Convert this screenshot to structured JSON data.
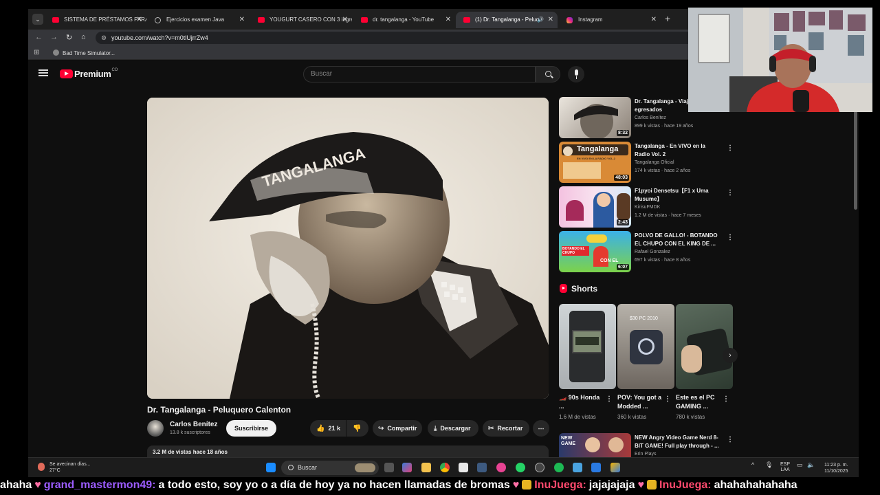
{
  "browser": {
    "tabs": [
      {
        "label": "SISTEMA DE PRÉSTAMOS PARA",
        "favicon": "youtube-icon"
      },
      {
        "label": "Ejercicios examen Java",
        "favicon": "globe-icon"
      },
      {
        "label": "YOUGURT CASERO CON 3 ingre",
        "favicon": "youtube-icon"
      },
      {
        "label": "dr. tangalanga - YouTube",
        "favicon": "youtube-icon"
      },
      {
        "label": "(1) Dr. Tangalanga - Peluqu",
        "favicon": "youtube-icon",
        "active": true
      },
      {
        "label": "Instagram",
        "favicon": "instagram-icon"
      }
    ],
    "url": "youtube.com/watch?v=m0tlUjrrZw4",
    "bookmark": "Bad Time Simulator..."
  },
  "youtube": {
    "logo_text": "Premium",
    "logo_sup": "CO",
    "search_placeholder": "Buscar"
  },
  "video": {
    "title": "Dr. Tangalanga - Peluquero Calenton",
    "channel": "Carlos Benítez",
    "subscribers": "13.8 k suscriptores",
    "subscribe_label": "Suscribirse",
    "likes": "21 k",
    "share_label": "Compartir",
    "download_label": "Descargar",
    "clip_label": "Recortar",
    "description_meta": "3.2 M de vistas  hace 18 años"
  },
  "recommendations": [
    {
      "title": "Dr. Tangalanga - Viaje de egresados",
      "channel": "Carlos Benítez",
      "meta": "899 k vistas · hace 19 años",
      "duration": "8:32"
    },
    {
      "title": "Tangalanga - En VIVO en la Radio Vol. 2",
      "channel": "Tangalanga Oficial",
      "meta": "174 k vistas · hace 2 años",
      "duration": "48:03",
      "thumb_text": "Tangalanga",
      "thumb_sub": "EN VIVO EN LA RADIO VOL.2"
    },
    {
      "title": "F1pyoi Densetsu【F1 x Uma Musume】",
      "channel": "KirisuFMDK",
      "meta": "1.2 M de vistas · hace 7 meses",
      "duration": "2:43"
    },
    {
      "title": "POLVO DE GALLO! - BOTANDO EL CHUPO CON EL KING DE ...",
      "channel": "Rafael Gonzalez",
      "meta": "697 k vistas · hace 8 años",
      "duration": "6:07",
      "thumb_text": "BOTANDO EL CHUPO",
      "thumb_sub": "CON EL"
    },
    {
      "title": "NEW Angry Video Game Nerd 8-BIT GAME! Full play through - ...",
      "channel": "Erin Plays",
      "meta": "",
      "thumb_text": "NEW GAME"
    }
  ],
  "shorts": {
    "heading": "Shorts",
    "items": [
      {
        "title": "🏎️ 90s Honda ...",
        "views": "1.6 M de vistas"
      },
      {
        "title": "POV: You got a Modded ...",
        "views": "360 k vistas",
        "thumb_text": "$30 PC 2010"
      },
      {
        "title": "Este es el PC GAMING ...",
        "views": "780 k vistas"
      }
    ]
  },
  "taskbar": {
    "weather_text": "Se avecinan días...",
    "temperature": "27°C",
    "search_placeholder": "Buscar",
    "lang_top": "ESP",
    "lang_bottom": "LAA",
    "time": "11:23 p. m.",
    "date": "11/10/2025"
  },
  "chat_ticker": [
    {
      "type": "msg",
      "text": "ahaha"
    },
    {
      "type": "user",
      "variant": 1,
      "text": "grand_mastermon49:"
    },
    {
      "type": "msg",
      "text": "a todo esto, soy yo o a día de hoy ya no hacen llamadas de bromas"
    },
    {
      "type": "user",
      "variant": 2,
      "text": "InuJuega:"
    },
    {
      "type": "msg",
      "text": "jajajajaja"
    },
    {
      "type": "user",
      "variant": 2,
      "text": "InuJuega:"
    },
    {
      "type": "msg",
      "text": "ahahahahahaha"
    }
  ],
  "colors": {
    "youtube_red": "#ff0033",
    "background": "#0f0f0f",
    "chat_user_purple": "#9c5cff",
    "chat_user_pink": "#ff4a6e"
  }
}
